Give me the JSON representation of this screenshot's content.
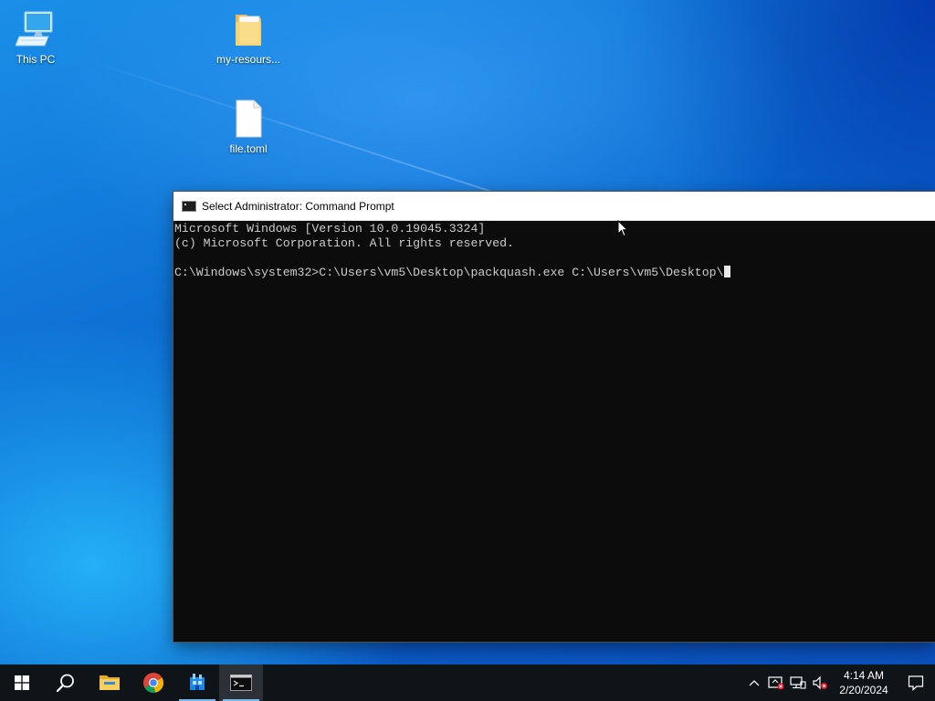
{
  "desktop": {
    "icons": [
      {
        "label": "This PC",
        "icon": "computer-icon"
      },
      {
        "label": "my-resours...",
        "icon": "folder-icon"
      },
      {
        "label": "file.toml",
        "icon": "file-icon"
      }
    ]
  },
  "console": {
    "title": "Select Administrator: Command Prompt",
    "lines": [
      "Microsoft Windows [Version 10.0.19045.3324]",
      "(c) Microsoft Corporation. All rights reserved.",
      "",
      "C:\\Windows\\system32>C:\\Users\\vm5\\Desktop\\packquash.exe C:\\Users\\vm5\\Desktop\\"
    ]
  },
  "taskbar": {
    "items": [
      {
        "icon": "windows-start-icon"
      },
      {
        "icon": "search-icon"
      },
      {
        "icon": "file-explorer-icon"
      },
      {
        "icon": "chrome-icon"
      },
      {
        "icon": "app-icon"
      },
      {
        "icon": "command-prompt-icon"
      }
    ],
    "tray": [
      "chevron-up-icon",
      "security-icon",
      "network-icon",
      "volume-muted-icon"
    ],
    "clock": {
      "time": "4:14 AM",
      "date": "2/20/2024"
    }
  },
  "colors": {
    "taskbar_bg": "#0f1419",
    "console_bg": "#0c0c0c",
    "console_text": "#cccccc",
    "accent": "#76b9ed"
  }
}
